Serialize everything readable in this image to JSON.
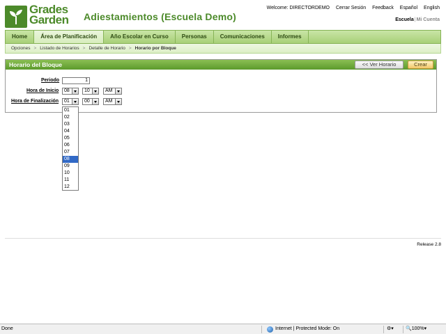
{
  "header": {
    "logo_line1": "Grades",
    "logo_line2": "Garden",
    "title": "Adiestamientos (Escuela Demo)",
    "welcome": "Welcome: DIRECTORDEMO",
    "links": [
      "Cerrar Sesión",
      "Feedback",
      "Español",
      "English"
    ],
    "school": "Escuela",
    "account": "Mi Cuenta"
  },
  "nav": {
    "items": [
      "Home",
      "Área de Planificación",
      "Año Escolar en Curso",
      "Personas",
      "Comunicaciones",
      "Informes"
    ],
    "active_index": 1
  },
  "breadcrumb": [
    "Opciones",
    "Listado de Horarios",
    "Detalle de Horario",
    "Horario por Bloque"
  ],
  "panel": {
    "title": "Horario del Bloque",
    "back_button": "<< Ver Horario",
    "create_button": "Crear"
  },
  "form": {
    "periodo_label": "Periodo",
    "periodo_value": "1",
    "inicio_label": "Hora de Inicio",
    "inicio_hour": "08",
    "inicio_min": "10",
    "inicio_ampm": "AM",
    "fin_label": "Hora de Finalización",
    "fin_hour": "01",
    "fin_min": "00",
    "fin_ampm": "AM"
  },
  "dropdown": {
    "options": [
      "01",
      "02",
      "03",
      "04",
      "05",
      "06",
      "07",
      "08",
      "09",
      "10",
      "11",
      "12"
    ],
    "highlighted": "08"
  },
  "footer": {
    "release": "Release 2.8"
  },
  "statusbar": {
    "status": "Done",
    "zone": "Internet | Protected Mode: On",
    "zoom": "100%"
  },
  "colors": {
    "brand_green": "#4c8a2a",
    "nav_green": "#a8d078",
    "create_orange": "#f3c86a",
    "selection_blue": "#3169c6"
  }
}
